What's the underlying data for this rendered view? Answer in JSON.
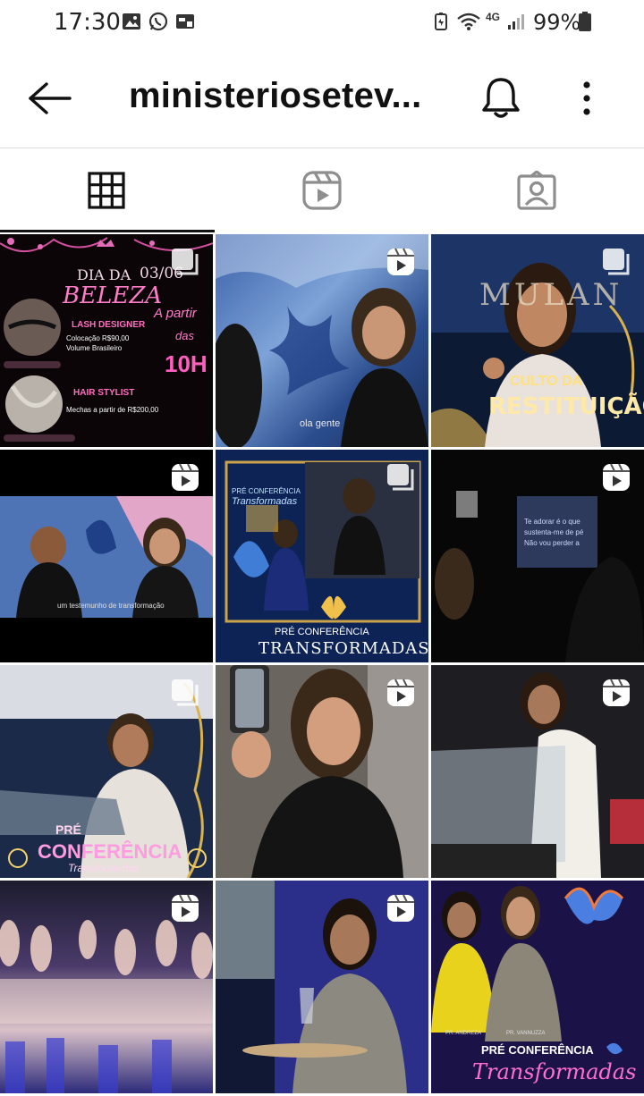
{
  "status_bar": {
    "time": "17:30",
    "battery": "99%",
    "network": "4G"
  },
  "header": {
    "title": "ministeriosetev..."
  },
  "tabs": [
    {
      "name": "grid",
      "icon": "grid-icon",
      "active": true
    },
    {
      "name": "reels",
      "icon": "reels-icon",
      "active": false
    },
    {
      "name": "tagged",
      "icon": "tagged-icon",
      "active": false
    }
  ],
  "posts": {
    "p1": {
      "badge": "multi",
      "title": "DIA DA",
      "date": "03/06",
      "beleza": "BELEZA",
      "a_partir": "A partir",
      "das": "das",
      "hour": "10H",
      "lash_title": "LASH DESIGNER",
      "lash_line1": "Colocação R$90,00",
      "lash_line2": "Volume Brasileiro",
      "hair_title": "HAIR STYLIST",
      "hair_line1": "Mechas a partir  de  R$200,00"
    },
    "p2": {
      "badge": "reel",
      "caption": "ola gente"
    },
    "p3": {
      "badge": "multi",
      "headline": "MULAN",
      "line1": "CULTO DA",
      "line2": "RESTITUIÇÃO"
    },
    "p4": {
      "badge": "reel",
      "caption": "um testemunho de transformação"
    },
    "p5": {
      "badge": "multi",
      "small1": "PRÉ CONFERÊNCIA",
      "small2": "Transformadas",
      "line1": "PRÉ CONFERÊNCIA",
      "line2": "TRANSFORMADAS"
    },
    "p6": {
      "badge": "reel",
      "line1": "Te adorar é o que",
      "line2": "sustenta-me de pé",
      "line3": "Não vou perder a"
    },
    "p7": {
      "badge": "multi",
      "line1": "PRÉ",
      "line2": "CONFERÊNCIA",
      "line3": "Transformadas"
    },
    "p8": {
      "badge": "reel"
    },
    "p9": {
      "badge": "reel"
    },
    "p10": {
      "badge": "reel"
    },
    "p11": {
      "badge": "reel"
    },
    "p12": {
      "name1": "PR. ANDREZA",
      "name2": "PR. VANNUZZA",
      "line1": "PRÉ CONFERÊNCIA",
      "line2": "Transformadas"
    }
  },
  "colors": {
    "accent_pink": "#ff4fb3",
    "gold": "#d9b24c",
    "ui_dark": "#111111",
    "ui_gray": "#8e8e8e"
  }
}
